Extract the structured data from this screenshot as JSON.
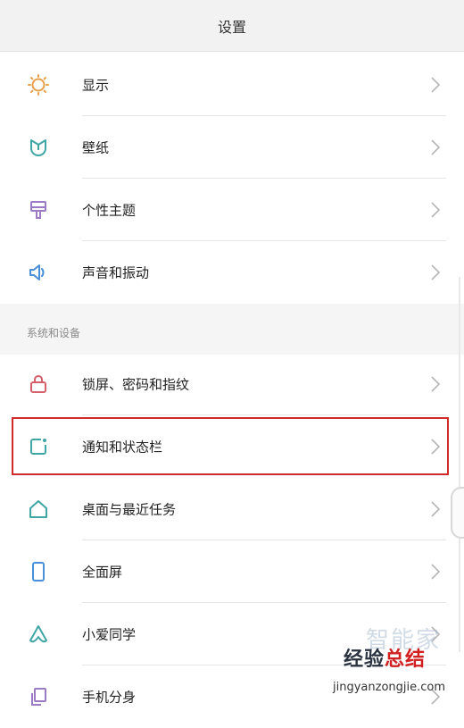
{
  "header": {
    "title": "设置"
  },
  "section1": {
    "items": [
      {
        "label": "显示",
        "icon": "brightness-icon"
      },
      {
        "label": "壁纸",
        "icon": "wallpaper-tulip-icon"
      },
      {
        "label": "个性主题",
        "icon": "theme-brush-icon"
      },
      {
        "label": "声音和振动",
        "icon": "speaker-icon"
      }
    ]
  },
  "section2": {
    "title": "系统和设备",
    "items": [
      {
        "label": "锁屏、密码和指纹",
        "icon": "lock-icon"
      },
      {
        "label": "通知和状态栏",
        "icon": "notification-icon"
      },
      {
        "label": "桌面与最近任务",
        "icon": "home-icon"
      },
      {
        "label": "全面屏",
        "icon": "phone-icon"
      },
      {
        "label": "小爱同学",
        "icon": "xiaoai-icon"
      },
      {
        "label": "手机分身",
        "icon": "clone-icon"
      }
    ]
  },
  "watermark": {
    "brand_pale": "智能家",
    "brand_dark": "经验",
    "brand_red": "总结",
    "url": "jingyanzongjie.com"
  },
  "colors": {
    "orange_icon": "#e8a04a",
    "teal_icon": "#3fa6a6",
    "purple_icon": "#9b7bc4",
    "blue_icon": "#4a90d9",
    "red_lock": "#d55f6a",
    "highlight": "#d12a2a"
  }
}
